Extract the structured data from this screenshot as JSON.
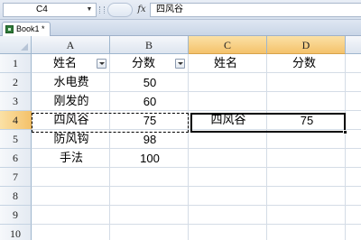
{
  "formula_bar": {
    "name_box": "C4",
    "fx_label": "fx",
    "formula": "四风谷"
  },
  "workbook_tab": {
    "label": "Book1 *"
  },
  "columns": [
    "A",
    "B",
    "C",
    "D"
  ],
  "rows": [
    "1",
    "2",
    "3",
    "4",
    "5",
    "6",
    "7",
    "8",
    "9",
    "10"
  ],
  "cells": {
    "A1": "姓名",
    "B1": "分数",
    "C1": "姓名",
    "D1": "分数",
    "A2": "水电费",
    "B2": "50",
    "A3": "刚发的",
    "B3": "60",
    "A4": "四风谷",
    "B4": "75",
    "C4": "四风谷",
    "D4": "75",
    "A5": "防风钩",
    "B5": "98",
    "A6": "手法",
    "B6": "100"
  },
  "selection": {
    "active_column": "C",
    "active_row": "4"
  },
  "colors": {
    "header_active": "#f4c26b",
    "grid_line": "#d4dce6"
  }
}
